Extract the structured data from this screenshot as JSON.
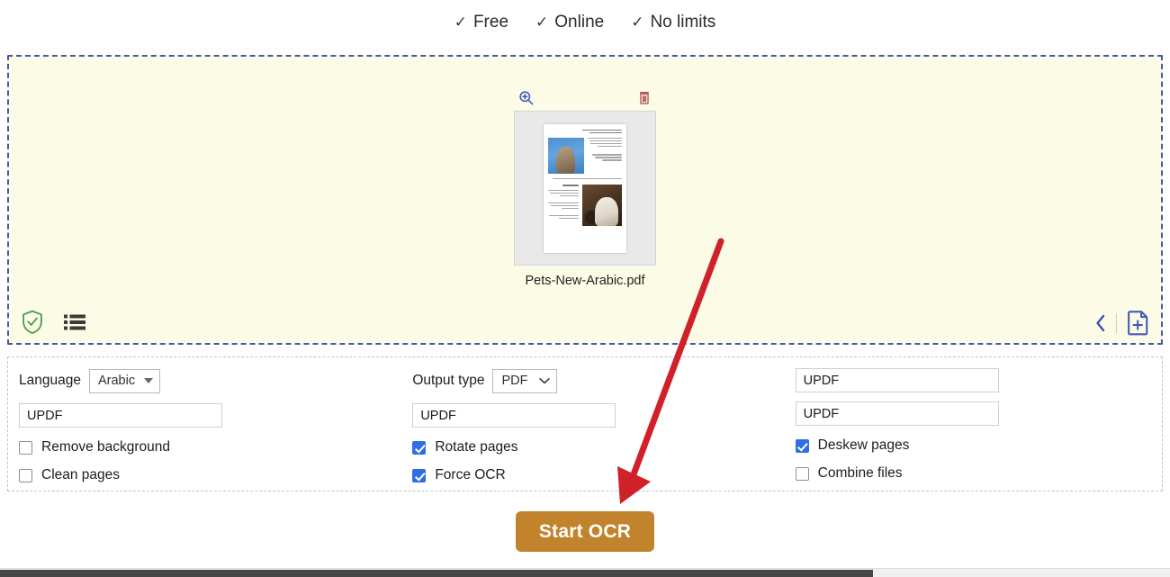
{
  "tagline": {
    "check_glyph": "✓",
    "items": [
      {
        "label": "Free"
      },
      {
        "label": "Online"
      },
      {
        "label": "No limits"
      }
    ]
  },
  "dropzone": {
    "file": {
      "name": "Pets-New-Arabic.pdf",
      "zoom_icon": "magnifier-plus-icon",
      "delete_icon": "trash-icon"
    },
    "bottom_left_icons": [
      {
        "name": "shield-check-icon"
      },
      {
        "name": "list-view-icon"
      }
    ],
    "bottom_right_icons": [
      {
        "name": "chevron-left-icon"
      },
      {
        "name": "add-file-icon"
      }
    ],
    "background_color": "#fcfce6",
    "border_color": "#4458a8"
  },
  "options": {
    "language": {
      "label": "Language",
      "value": "Arabic"
    },
    "output_type": {
      "label": "Output type",
      "value": "PDF"
    },
    "inputs": {
      "left_value": "UPDF",
      "middle_value": "UPDF",
      "right_top_value": "UPDF",
      "right_bottom_value": "UPDF"
    },
    "checkboxes": [
      {
        "label": "Remove background",
        "checked": false
      },
      {
        "label": "Clean pages",
        "checked": false
      },
      {
        "label": "Rotate pages",
        "checked": true
      },
      {
        "label": "Force OCR",
        "checked": true
      },
      {
        "label": "Deskew pages",
        "checked": true
      },
      {
        "label": "Combine files",
        "checked": false
      }
    ]
  },
  "action": {
    "start_label": "Start OCR",
    "start_color": "#c1832c"
  },
  "annotation": {
    "arrow_color": "#d0202a"
  }
}
